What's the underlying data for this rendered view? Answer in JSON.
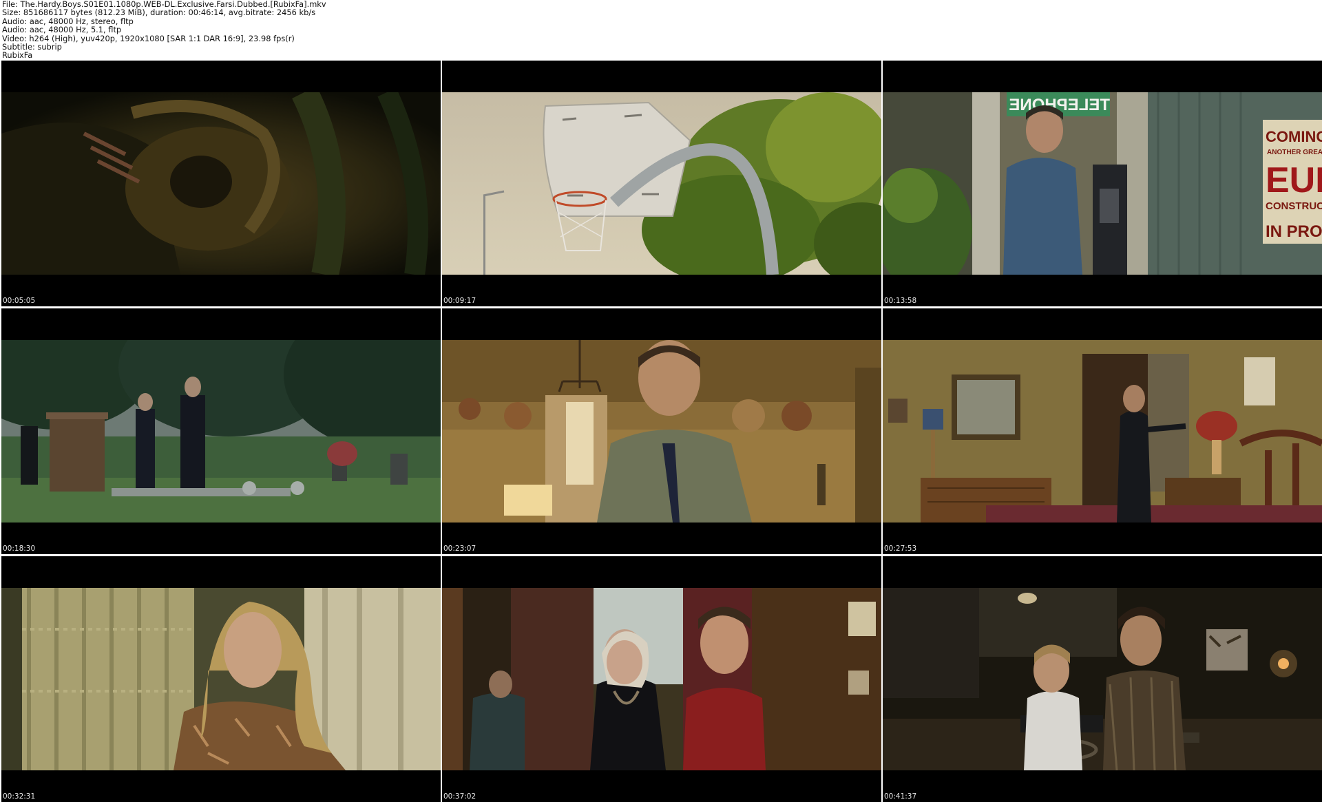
{
  "header": {
    "lines": [
      "File: The.Hardy.Boys.S01E01.1080p.WEB-DL.Exclusive.Farsi.Dubbed.[RubixFa].mkv",
      "Size: 851686117 bytes (812.23 MiB), duration: 00:46:14, avg.bitrate: 2456 kb/s",
      "Audio: aac, 48000 Hz, stereo, fltp",
      "Audio: aac, 48000 Hz, 5.1, fltp",
      "Video: h264 (High), yuv420p, 1920x1080 [SAR 1:1 DAR 16:9], 23.98 fps(r)",
      "Subtitle: subrip",
      "RubixFa"
    ]
  },
  "frames": [
    {
      "timestamp": "00:05:05",
      "scene": "dark-closeup"
    },
    {
      "timestamp": "00:09:17",
      "scene": "basketball-hoop"
    },
    {
      "timestamp": "00:13:58",
      "scene": "man-payphone",
      "signs": [
        "TELEPHONE",
        "COMING",
        "ANOTHER GREAT",
        "EUN",
        "CONSTRUCT",
        "IN PRO"
      ]
    },
    {
      "timestamp": "00:18:30",
      "scene": "cemetery"
    },
    {
      "timestamp": "00:23:07",
      "scene": "man-tie-room"
    },
    {
      "timestamp": "00:27:53",
      "scene": "bedroom-doorway"
    },
    {
      "timestamp": "00:32:31",
      "scene": "woman-window"
    },
    {
      "timestamp": "00:37:02",
      "scene": "grandmother-and-boys"
    },
    {
      "timestamp": "00:41:37",
      "scene": "boys-at-desk"
    }
  ],
  "colors": {
    "background": "#ffffff",
    "tile_background": "#000000",
    "timestamp_text": "#e6e6e6",
    "header_text": "#111111"
  }
}
